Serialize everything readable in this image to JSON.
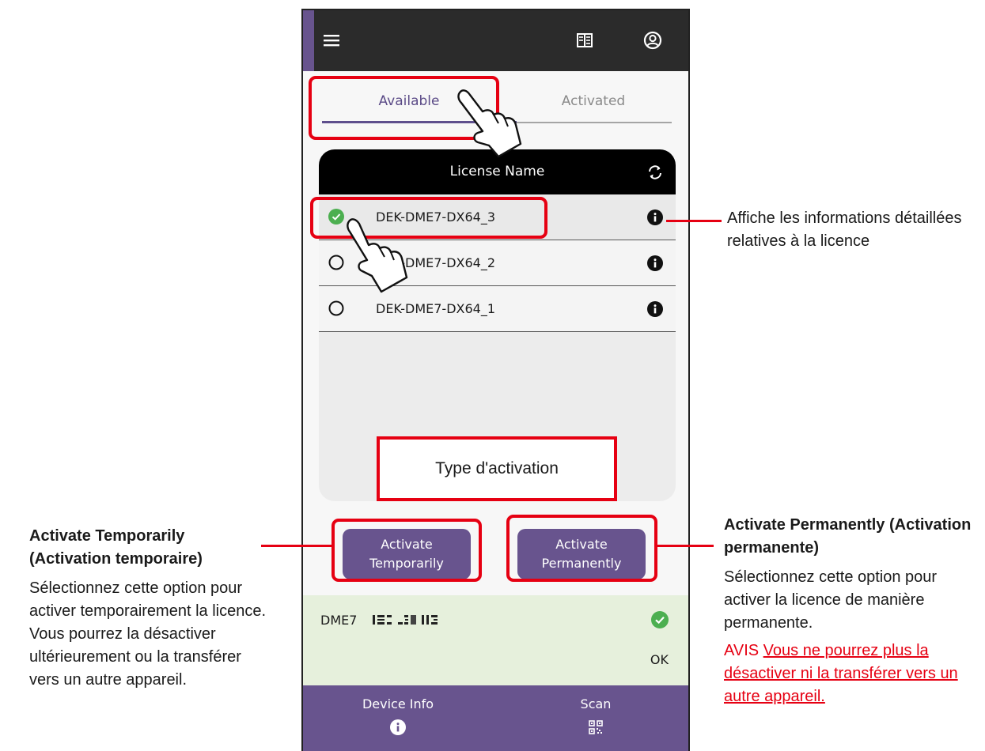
{
  "tabs": {
    "available": "Available",
    "activated": "Activated"
  },
  "list": {
    "header": "License Name",
    "items": [
      {
        "name": "DEK-DME7-DX64_3",
        "selected": true
      },
      {
        "name": "DEK-DME7-DX64_2",
        "selected": false
      },
      {
        "name": "DEK-DME7-DX64_1",
        "selected": false
      }
    ]
  },
  "buttons": {
    "temporarily": "Activate\nTemporarily",
    "permanently": "Activate\nPermanently"
  },
  "status": {
    "device": "DME7",
    "result": "OK"
  },
  "bottom_nav": {
    "device_info": "Device Info",
    "scan": "Scan"
  },
  "callouts": {
    "type_activation": "Type d'activation",
    "info": "Affiche les informations détaillées relatives à la licence",
    "temp_title": "Activate Temporarily (Activation temporaire)",
    "temp_body": "Sélectionnez cette option pour activer temporairement la licence. Vous pourrez la désactiver ultérieurement ou la transférer vers un autre appareil.",
    "perm_title": "Activate Permanently (Activation permanente)",
    "perm_body": "Sélectionnez cette option pour activer la licence de manière permanente.",
    "notice_label": "AVIS",
    "notice_text": "Vous ne pourrez plus la désactiver ni la transférer vers un autre appareil."
  },
  "colors": {
    "accent": "#68548e",
    "highlight": "#e60012",
    "check": "#4caf50"
  }
}
